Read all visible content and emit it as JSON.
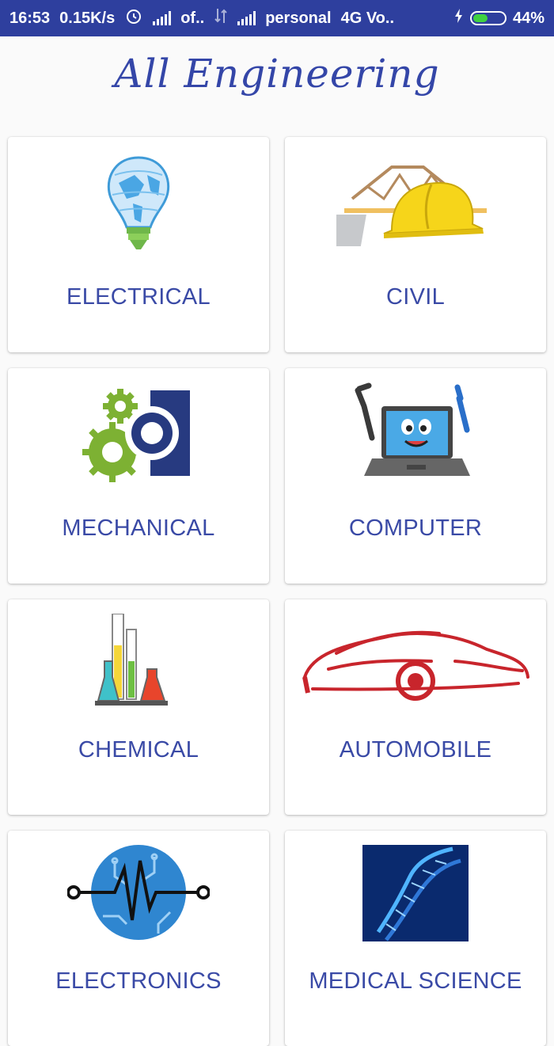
{
  "status_bar": {
    "time": "16:53",
    "speed": "0.15K/s",
    "carrier1": "of..",
    "carrier2": "personal",
    "network": "4G Vo..",
    "battery": "44%",
    "battery_level": 0.44
  },
  "app": {
    "title": "All Engineering"
  },
  "categories": [
    {
      "label": "ELECTRICAL",
      "icon": "lightbulb-icon"
    },
    {
      "label": "CIVIL",
      "icon": "hardhat-icon"
    },
    {
      "label": "MECHANICAL",
      "icon": "gears-icon"
    },
    {
      "label": "COMPUTER",
      "icon": "laptop-icon"
    },
    {
      "label": "CHEMICAL",
      "icon": "flasks-icon"
    },
    {
      "label": "AUTOMOBILE",
      "icon": "car-icon"
    },
    {
      "label": "ELECTRONICS",
      "icon": "circuit-icon"
    },
    {
      "label": "MEDICAL SCIENCE",
      "icon": "dna-icon"
    }
  ],
  "colors": {
    "status_bar": "#2e3f9e",
    "accent": "#3a4aa6"
  }
}
